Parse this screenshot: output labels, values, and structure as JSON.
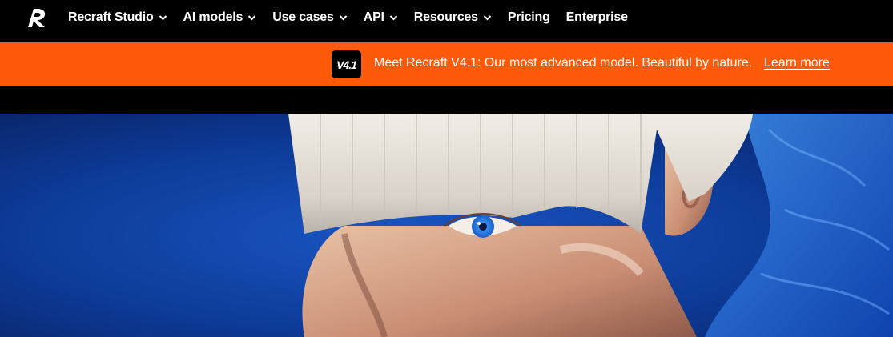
{
  "brand": {
    "logo_icon": "recraft-logo-icon"
  },
  "nav": {
    "items": [
      {
        "label": "Recraft Studio",
        "has_dropdown": true
      },
      {
        "label": "AI models",
        "has_dropdown": true
      },
      {
        "label": "Use cases",
        "has_dropdown": true
      },
      {
        "label": "API",
        "has_dropdown": true
      },
      {
        "label": "Resources",
        "has_dropdown": true
      },
      {
        "label": "Pricing",
        "has_dropdown": false
      },
      {
        "label": "Enterprise",
        "has_dropdown": false
      }
    ]
  },
  "banner": {
    "badge": "V4.1",
    "text": "Meet Recraft V4.1: Our most advanced model. Beautiful by nature.",
    "link": "Learn more",
    "color": "#ff5a0a"
  },
  "hero": {
    "image": "portrait-platinum-bob-blue-eyes",
    "background_color": "#0d3fa0"
  }
}
